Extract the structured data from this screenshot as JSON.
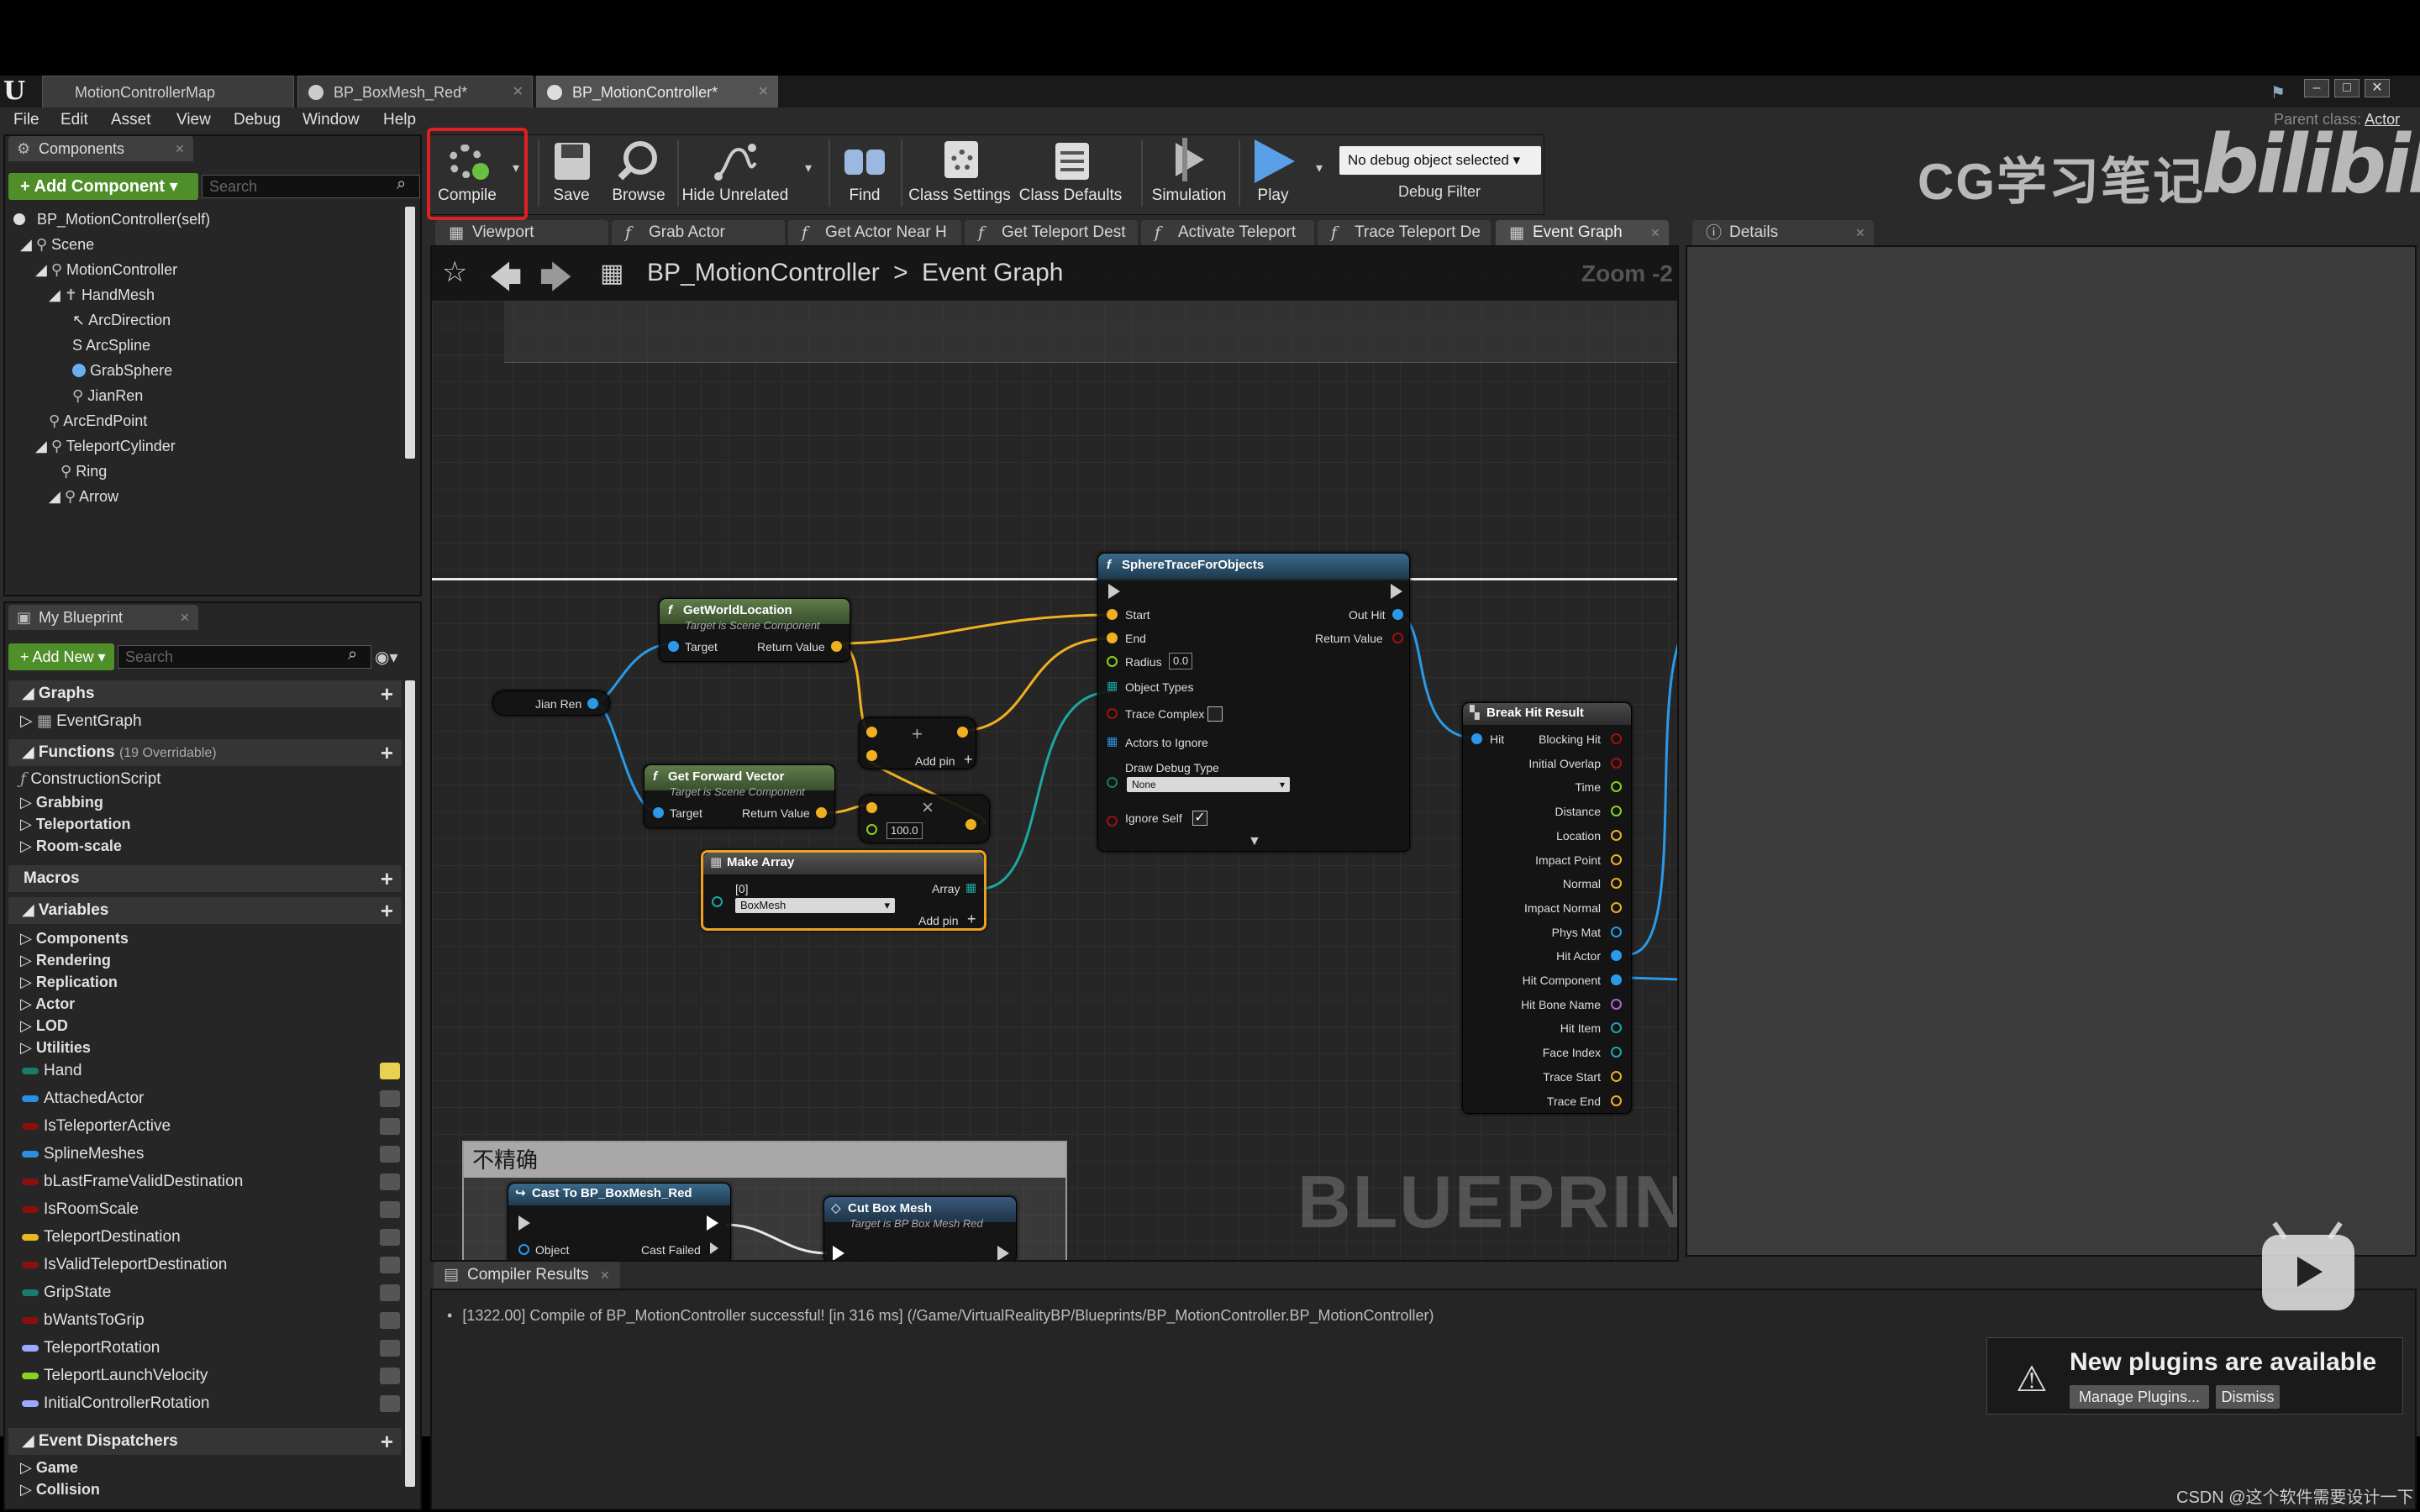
{
  "window": {
    "tabs": [
      {
        "label": "MotionControllerMap"
      },
      {
        "label": "BP_BoxMesh_Red*"
      },
      {
        "label": "BP_MotionController*"
      }
    ],
    "parent_class_label": "Parent class:",
    "parent_class_value": "Actor",
    "min_glyph": "–",
    "max_glyph": "□",
    "close_glyph": "✕"
  },
  "menu": [
    "File",
    "Edit",
    "Asset",
    "View",
    "Debug",
    "Window",
    "Help"
  ],
  "components_panel": {
    "tab": "Components",
    "add_button": "+ Add Component ▾",
    "search_placeholder": "Search",
    "self_label": "BP_MotionController(self)",
    "tree": [
      "Scene",
      "MotionController",
      "HandMesh",
      "ArcDirection",
      "ArcSpline",
      "GrabSphere",
      "JianRen",
      "ArcEndPoint",
      "TeleportCylinder",
      "Ring",
      "Arrow"
    ]
  },
  "my_blueprint": {
    "tab": "My Blueprint",
    "add_button": "+ Add New ▾",
    "search_placeholder": "Search",
    "graphs_header": "Graphs",
    "graphs": [
      "EventGraph"
    ],
    "functions_header": "Functions",
    "functions_count": "(19 Overridable)",
    "functions": [
      "ConstructionScript"
    ],
    "function_categories": [
      "Grabbing",
      "Teleportation",
      "Room-scale"
    ],
    "macros_header": "Macros",
    "variables_header": "Variables",
    "variable_categories": [
      "Components",
      "Rendering",
      "Replication",
      "Actor",
      "LOD",
      "Utilities"
    ],
    "variables": [
      {
        "name": "Hand",
        "color": "#1e7a6a"
      },
      {
        "name": "AttachedActor",
        "color": "#2a8fe0"
      },
      {
        "name": "IsTeleporterActive",
        "color": "#8a1010"
      },
      {
        "name": "SplineMeshes",
        "color": "#2a8fe0"
      },
      {
        "name": "bLastFrameValidDestination",
        "color": "#8a1010"
      },
      {
        "name": "IsRoomScale",
        "color": "#8a1010"
      },
      {
        "name": "TeleportDestination",
        "color": "#e8b820"
      },
      {
        "name": "IsValidTeleportDestination",
        "color": "#8a1010"
      },
      {
        "name": "GripState",
        "color": "#1e7a6a"
      },
      {
        "name": "bWantsToGrip",
        "color": "#8a1010"
      },
      {
        "name": "TeleportRotation",
        "color": "#9aa8ff"
      },
      {
        "name": "TeleportLaunchVelocity",
        "color": "#8ad020"
      },
      {
        "name": "InitialControllerRotation",
        "color": "#9aa8ff"
      }
    ],
    "event_dispatchers_header": "Event Dispatchers",
    "dispatcher_categories": [
      "Game",
      "Collision"
    ]
  },
  "toolbar": {
    "compile": "Compile",
    "save": "Save",
    "browse": "Browse",
    "hide_unrelated": "Hide Unrelated",
    "find": "Find",
    "class_settings": "Class Settings",
    "class_defaults": "Class Defaults",
    "simulation": "Simulation",
    "play": "Play",
    "debug_select": "No debug object selected ▾",
    "debug_filter": "Debug Filter"
  },
  "watermark": {
    "text": "CG学习笔记",
    "logo": "bilibili"
  },
  "graph_tabs": [
    "Viewport",
    "Grab Actor",
    "Get Actor Near H",
    "Get Teleport Dest",
    "Activate Teleport",
    "Trace Teleport De",
    "Event Graph"
  ],
  "details_tab": "Details",
  "breadcrumb": {
    "root": "BP_MotionController",
    "sep": ">",
    "current": "Event Graph"
  },
  "zoom": "Zoom -2",
  "graph_watermark": "BLUEPRINT",
  "nodes": {
    "jian_ren": "Jian Ren",
    "get_world_location": {
      "title": "GetWorldLocation",
      "sub": "Target is Scene Component",
      "target": "Target",
      "ret": "Return Value"
    },
    "get_forward_vector": {
      "title": "Get Forward Vector",
      "sub": "Target is Scene Component",
      "target": "Target",
      "ret": "Return Value"
    },
    "add": {
      "symbol": "+",
      "add_pin": "Add pin"
    },
    "multiply": {
      "symbol": "×",
      "value": "100.0"
    },
    "make_array": {
      "title": "Make Array",
      "index": "[0]",
      "array": "Array",
      "option": "BoxMesh",
      "add_pin": "Add pin"
    },
    "sphere_trace": {
      "title": "SphereTraceForObjects",
      "start": "Start",
      "end": "End",
      "radius": "Radius",
      "radius_value": "0.0",
      "object_types": "Object Types",
      "trace_complex": "Trace Complex",
      "actors_to_ignore": "Actors to Ignore",
      "draw_debug": "Draw Debug Type",
      "draw_debug_value": "None",
      "ignore_self": "Ignore Self",
      "out_hit": "Out Hit",
      "return_value": "Return Value"
    },
    "break_hit": {
      "title": "Break Hit Result",
      "hit": "Hit",
      "outputs": [
        "Blocking Hit",
        "Initial Overlap",
        "Time",
        "Distance",
        "Location",
        "Impact Point",
        "Normal",
        "Impact Normal",
        "Phys Mat",
        "Hit Actor",
        "Hit Component",
        "Hit Bone Name",
        "Hit Item",
        "Face Index",
        "Trace Start",
        "Trace End"
      ]
    },
    "comment": "不精确",
    "cast": {
      "title": "Cast To BP_BoxMesh_Red",
      "object": "Object",
      "cast_failed": "Cast Failed"
    },
    "cut_box": {
      "title": "Cut Box Mesh",
      "sub": "Target is BP Box Mesh Red"
    }
  },
  "compiler": {
    "tab": "Compiler Results",
    "message": "[1322.00] Compile of BP_MotionController successful! [in 316 ms] (/Game/VirtualRealityBP/Blueprints/BP_MotionController.BP_MotionController)"
  },
  "notification": {
    "title": "New plugins are available",
    "manage": "Manage Plugins...",
    "dismiss": "Dismiss"
  },
  "footer": "CSDN @这个软件需要设计一下"
}
